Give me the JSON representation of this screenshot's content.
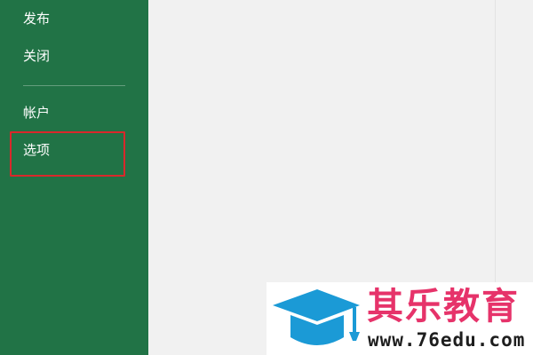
{
  "sidebar": {
    "background": "#217346",
    "items": [
      {
        "label": "发布"
      },
      {
        "label": "关闭"
      },
      {
        "label": "帐户"
      },
      {
        "label": "选项"
      }
    ],
    "highlight_color": "#d9282b"
  },
  "watermark": {
    "title": "其乐教育",
    "url": "www.76edu.com",
    "icon": "graduation-cap-icon",
    "title_color": "#e6336a",
    "icon_color": "#1b9ad6"
  }
}
